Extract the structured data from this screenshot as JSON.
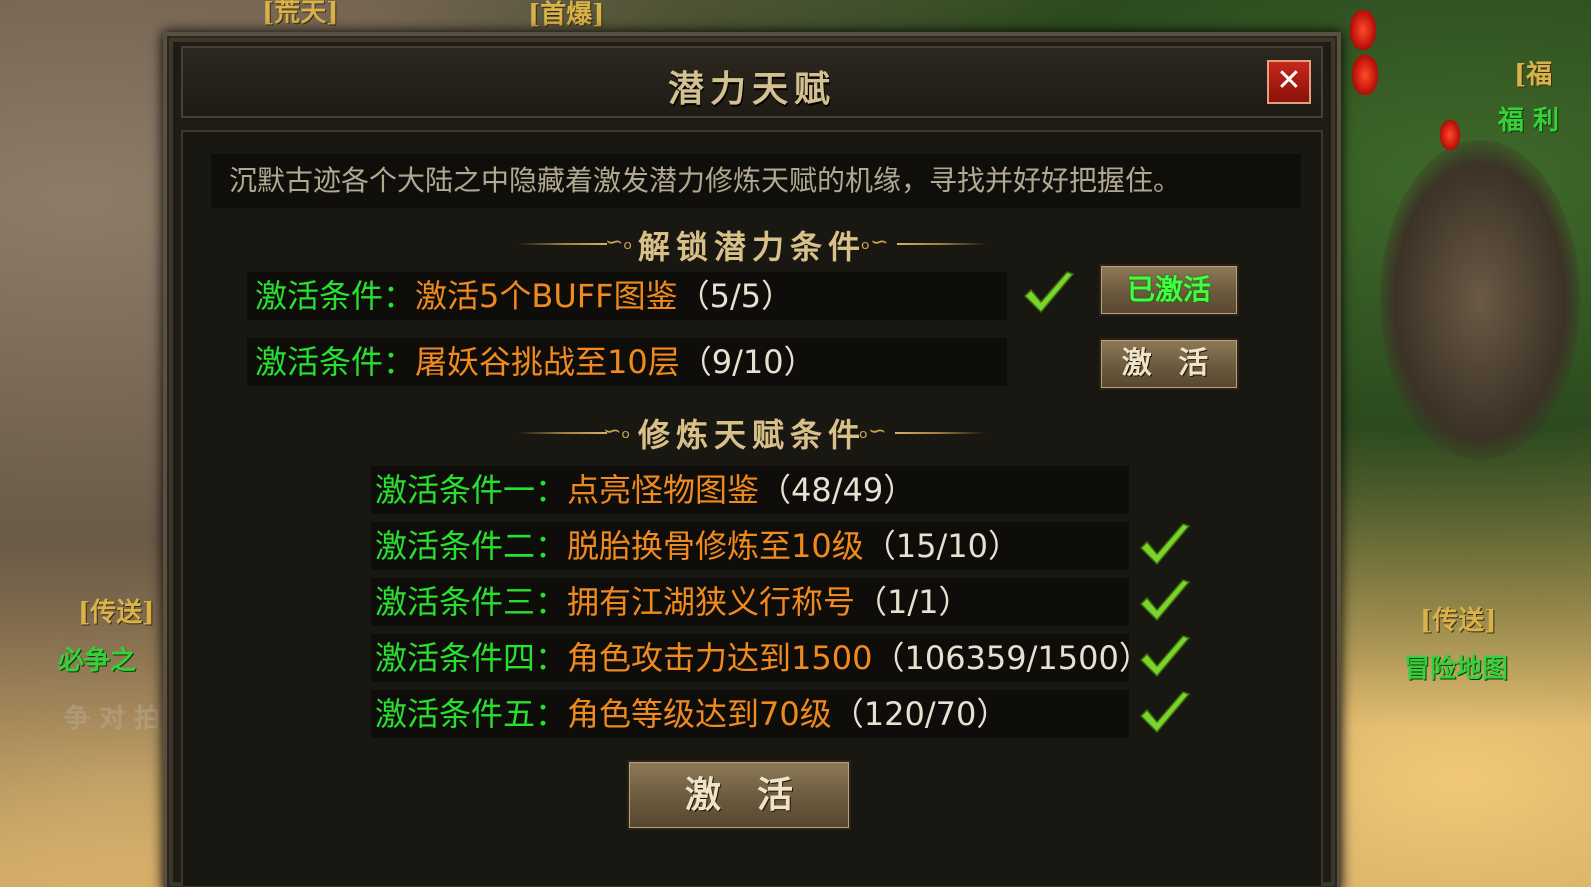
{
  "world": {
    "top_label_left": "[荒天]",
    "top_label_center": "[首爆]",
    "right_top_label": "[福",
    "right_top_sub": "福 利",
    "left_teleport": "[传送]",
    "left_teleport_name": "必争之",
    "left_faint": "争 对 拍",
    "right_teleport": "[传送]",
    "right_teleport_name": "冒险地图"
  },
  "dialog": {
    "title": "潜力天赋",
    "close_label": "✕",
    "description": "沉默古迹各个大陆之中隐藏着激发潜力修炼天赋的机缘，寻找并好好把握住。"
  },
  "unlock": {
    "section_title": "解锁潜力条件",
    "rows": [
      {
        "label": "激活条件：",
        "requirement": "激活5个BUFF图鉴",
        "progress": "（5/5）",
        "done": true,
        "button": "已激活"
      },
      {
        "label": "激活条件：",
        "requirement": "屠妖谷挑战至10层",
        "progress": "（9/10）",
        "done": false,
        "button": "激 活"
      }
    ]
  },
  "cultivate": {
    "section_title": "修炼天赋条件",
    "rows": [
      {
        "label": "激活条件一：",
        "requirement": "点亮怪物图鉴",
        "progress": "（48/49）",
        "done": false
      },
      {
        "label": "激活条件二：",
        "requirement": "脱胎换骨修炼至10级",
        "progress": "（15/10）",
        "done": true
      },
      {
        "label": "激活条件三：",
        "requirement": "拥有江湖狭义行称号",
        "progress": "（1/1）",
        "done": true
      },
      {
        "label": "激活条件四：",
        "requirement": "角色攻击力达到1500",
        "progress": "（106359/1500）",
        "done": true
      },
      {
        "label": "激活条件五：",
        "requirement": "角色等级达到70级",
        "progress": "（120/70）",
        "done": true
      }
    ],
    "activate_button": "激　活"
  },
  "colors": {
    "label_green": "#28e030",
    "requirement_orange": "#f08a1e",
    "progress_white": "#e8e0d0",
    "check_green": "#7ad42a"
  },
  "icons": {
    "check": "check-icon",
    "close": "close-icon"
  }
}
